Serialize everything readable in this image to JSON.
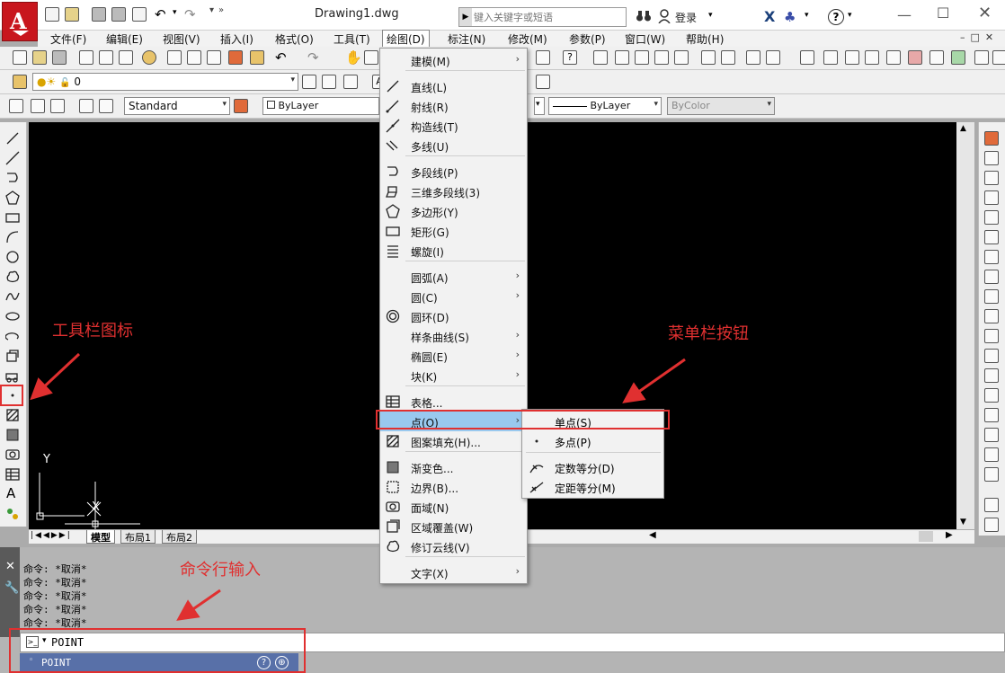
{
  "title_bar": {
    "doc_title": "Drawing1.dwg",
    "search_placeholder": "键入关键字或短语",
    "login_label": "登录"
  },
  "menubar": {
    "items": [
      "文件(F)",
      "编辑(E)",
      "视图(V)",
      "插入(I)",
      "格式(O)",
      "工具(T)",
      "绘图(D)",
      "标注(N)",
      "修改(M)",
      "参数(P)",
      "窗口(W)",
      "帮助(H)"
    ],
    "active": "绘图(D)"
  },
  "toolbars": {
    "layer_value": "0",
    "text_style": "Standard",
    "color_value": "ByLayer",
    "linetype_value": "ByLayer",
    "plotstyle_value": "ByColor"
  },
  "layout_tabs": [
    "模型",
    "布局1",
    "布局2"
  ],
  "ucs": {
    "y_label": "Y",
    "x_label": "X"
  },
  "draw_menu": {
    "items": [
      {
        "label": "建模(M)",
        "icon": "none",
        "submenu": true
      },
      {
        "label": "直线(L)",
        "icon": "line-icon",
        "submenu": false
      },
      {
        "label": "射线(R)",
        "icon": "ray-icon",
        "submenu": false
      },
      {
        "label": "构造线(T)",
        "icon": "xline-icon",
        "submenu": false
      },
      {
        "label": "多线(U)",
        "icon": "mline-icon",
        "submenu": false
      },
      {
        "label": "多段线(P)",
        "icon": "polyline-icon",
        "submenu": false
      },
      {
        "label": "三维多段线(3)",
        "icon": "3dpoly-icon",
        "submenu": false
      },
      {
        "label": "多边形(Y)",
        "icon": "polygon-icon",
        "submenu": false
      },
      {
        "label": "矩形(G)",
        "icon": "rectangle-icon",
        "submenu": false
      },
      {
        "label": "螺旋(I)",
        "icon": "helix-icon",
        "submenu": false
      },
      {
        "label": "圆弧(A)",
        "icon": "none",
        "submenu": true
      },
      {
        "label": "圆(C)",
        "icon": "none",
        "submenu": true
      },
      {
        "label": "圆环(D)",
        "icon": "donut-icon",
        "submenu": false
      },
      {
        "label": "样条曲线(S)",
        "icon": "none",
        "submenu": true
      },
      {
        "label": "椭圆(E)",
        "icon": "none",
        "submenu": true
      },
      {
        "label": "块(K)",
        "icon": "none",
        "submenu": true
      },
      {
        "label": "表格...",
        "icon": "table-icon",
        "submenu": false
      },
      {
        "label": "点(O)",
        "icon": "none",
        "submenu": true
      },
      {
        "label": "图案填充(H)...",
        "icon": "hatch-icon",
        "submenu": false
      },
      {
        "label": "渐变色...",
        "icon": "gradient-icon",
        "submenu": false
      },
      {
        "label": "边界(B)...",
        "icon": "boundary-icon",
        "submenu": false
      },
      {
        "label": "面域(N)",
        "icon": "region-icon",
        "submenu": false
      },
      {
        "label": "区域覆盖(W)",
        "icon": "wipeout-icon",
        "submenu": false
      },
      {
        "label": "修订云线(V)",
        "icon": "revcloud-icon",
        "submenu": false
      },
      {
        "label": "文字(X)",
        "icon": "none",
        "submenu": true
      }
    ],
    "highlighted": "点(O)"
  },
  "point_submenu": {
    "items": [
      {
        "label": "单点(S)",
        "icon": "none"
      },
      {
        "label": "多点(P)",
        "icon": "multipoint-icon"
      },
      {
        "label": "定数等分(D)",
        "icon": "divide-icon"
      },
      {
        "label": "定距等分(M)",
        "icon": "measure-icon"
      }
    ]
  },
  "annotations": {
    "toolbar_icon": "工具栏图标",
    "menu_button": "菜单栏按钮",
    "command_input": "命令行输入"
  },
  "command_line": {
    "history": [
      "命令: *取消*",
      "命令: *取消*",
      "命令: *取消*",
      "命令: *取消*",
      "命令: *取消*"
    ],
    "input_value": "POINT",
    "autocomplete": "POINT"
  },
  "colors": {
    "accent_red": "#e03030",
    "highlight": "#99c9ef",
    "autocad_red": "#c8161d",
    "autocomplete_bg": "#5870a8"
  }
}
